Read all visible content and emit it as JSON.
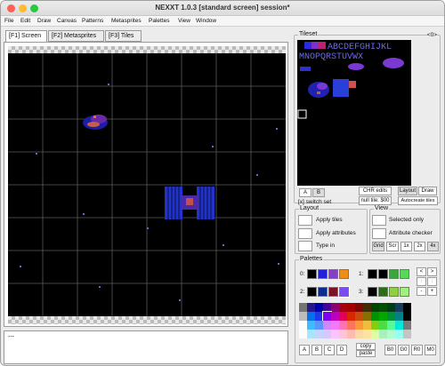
{
  "window": {
    "title": "NEXXT 1.0.3  [standard screen] session*"
  },
  "menu": [
    "File",
    "Edit",
    "Draw",
    "Canvas",
    "Patterns",
    "Metasprites",
    "Palettes",
    "View",
    "Window"
  ],
  "tabs": [
    "[F1] Screen",
    "[F2] Metasprites",
    "[F3] Tiles"
  ],
  "status": {
    "text": "---"
  },
  "tileset": {
    "label": "Tileset",
    "nav": "<0>",
    "bank_a": "A",
    "bank_b": "B",
    "chr_edits": "CHR edits",
    "layout": "Layout",
    "draw": "Draw",
    "switch_set": "[x] switch set",
    "null_tile": "null tile: $00",
    "autocreate": "Autocreate tiles"
  },
  "layout_group": {
    "label": "Layout",
    "apply_tiles": "Apply tiles",
    "apply_attributes": "Apply attributes",
    "type_in": "Type in"
  },
  "view_group": {
    "label": "View",
    "selected_only": "Selected only",
    "attribute_checker": "Attribute checker",
    "zoom": [
      "Grid",
      "Scr",
      "1x",
      "2x",
      "4x"
    ]
  },
  "palettes": {
    "label": "Palettes",
    "sets": [
      {
        "label": "0:",
        "colors": [
          "#000000",
          "#2420d8",
          "#8440c4",
          "#f08c18"
        ]
      },
      {
        "label": "1:",
        "colors": [
          "#000000",
          "#000000",
          "#3ca83c",
          "#58d858"
        ]
      },
      {
        "label": "2:",
        "colors": [
          "#000000",
          "#0c2c90",
          "#7c1024",
          "#7c4cf0"
        ]
      },
      {
        "label": "3:",
        "colors": [
          "#000000",
          "#2c6c1c",
          "#90d040",
          "#a0f080"
        ]
      }
    ],
    "arrows": [
      "<",
      ">",
      "↑",
      "↓",
      "-",
      "+"
    ],
    "master": [
      [
        "#747474",
        "#24188c",
        "#0000a8",
        "#44009c",
        "#8c0074",
        "#a80010",
        "#a40000",
        "#7c0800",
        "#402c00",
        "#004400",
        "#005000",
        "#003c14",
        "#183c5c",
        "#000000"
      ],
      [
        "#bcbcbc",
        "#0070ec",
        "#2038ec",
        "#8000f0",
        "#bc00bc",
        "#e40058",
        "#d82800",
        "#c84c0c",
        "#887000",
        "#009400",
        "#00a800",
        "#009038",
        "#008088",
        "#000000"
      ],
      [
        "#fcfcfc",
        "#3cbcfc",
        "#5c94fc",
        "#cc88fc",
        "#f478fc",
        "#fc74b4",
        "#fc7460",
        "#fc9838",
        "#f0bc3c",
        "#80d010",
        "#4cdc48",
        "#58f898",
        "#00e8d8",
        "#787878"
      ],
      [
        "#fcfcfc",
        "#a8e4fc",
        "#c4d4fc",
        "#d4c8fc",
        "#fcc4fc",
        "#fcc4d8",
        "#fcbcb0",
        "#fcd8a8",
        "#fce4a0",
        "#e0fca0",
        "#a8f0bc",
        "#b0fccc",
        "#9cfcf0",
        "#c4c4c4"
      ]
    ],
    "subpal": [
      "A",
      "B",
      "C",
      "D"
    ],
    "copy": "copy",
    "paste": "paste",
    "emph": [
      "B0",
      "G0",
      "R0",
      "M0"
    ]
  },
  "tileset_text": {
    "row1": "ABCDEFGHIJKL",
    "row2": "MNOPQRSTUVWX"
  }
}
